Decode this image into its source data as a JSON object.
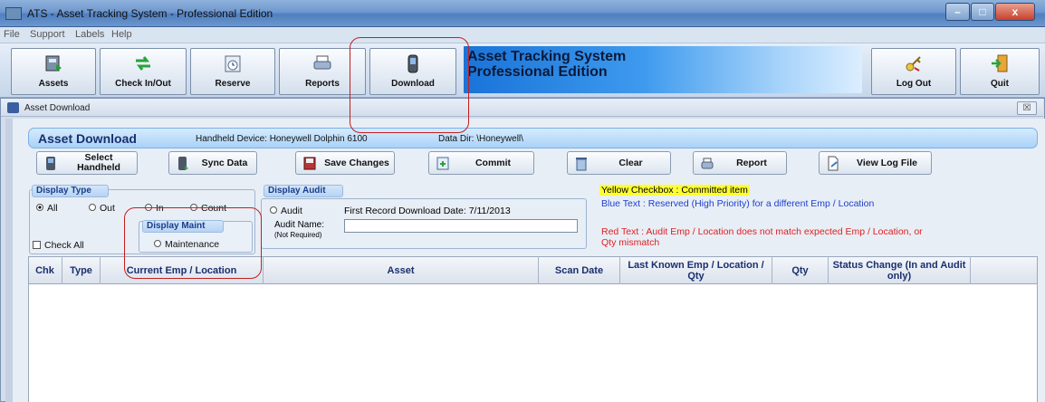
{
  "window": {
    "title": "ATS - Asset Tracking System - Professional Edition",
    "min": "–",
    "max": "□",
    "close": "x"
  },
  "menu": [
    "File",
    "Support",
    "Labels",
    "Help"
  ],
  "toolbar": {
    "assets": "Assets",
    "checkinout": "Check In/Out",
    "reserve": "Reserve",
    "reports": "Reports",
    "download": "Download",
    "logout": "Log Out",
    "quit": "Quit"
  },
  "banner": {
    "line1": "Asset Tracking System",
    "line2": "Professional Edition"
  },
  "child": {
    "title": "Asset Download",
    "close": "☒"
  },
  "header": {
    "title": "Asset Download",
    "device": "Handheld Device:  Honeywell Dolphin 6100",
    "dir": "Data Dir:  \\Honeywell\\"
  },
  "actions": {
    "select_handheld": "Select Handheld",
    "sync": "Sync Data",
    "save": "Save Changes",
    "commit": "Commit",
    "clear": "Clear",
    "report": "Report",
    "view_log": "View Log File"
  },
  "display_type": {
    "label": "Display Type",
    "all": "All",
    "out": "Out",
    "in": "In",
    "count": "Count",
    "checkall": "Check All"
  },
  "display_maint": {
    "label": "Display Maint",
    "maintenance": "Maintenance"
  },
  "display_audit": {
    "label": "Display Audit",
    "audit": "Audit",
    "first_record": "First Record Download Date:  7/11/2013",
    "audit_name": "Audit Name:",
    "not_required": "(Not Required)"
  },
  "legend": {
    "yellow": "Yellow Checkbox :  Committed item",
    "blue": "Blue Text :  Reserved (High Priority) for a different Emp / Location",
    "red": "Red Text :  Audit Emp / Location does not match expected Emp / Location, or Qty mismatch"
  },
  "table": {
    "columns": [
      "Chk",
      "Type",
      "Current Emp / Location",
      "Asset",
      "Scan Date",
      "Last Known Emp / Location / Qty",
      "Qty",
      "Status Change (In and Audit only)"
    ]
  },
  "colors": {
    "banner": "#1a73d8",
    "highlight": "#c41e1e",
    "legend_yellow": "#ffff33",
    "legend_blue": "#1f3fcc",
    "legend_red": "#e02020"
  }
}
